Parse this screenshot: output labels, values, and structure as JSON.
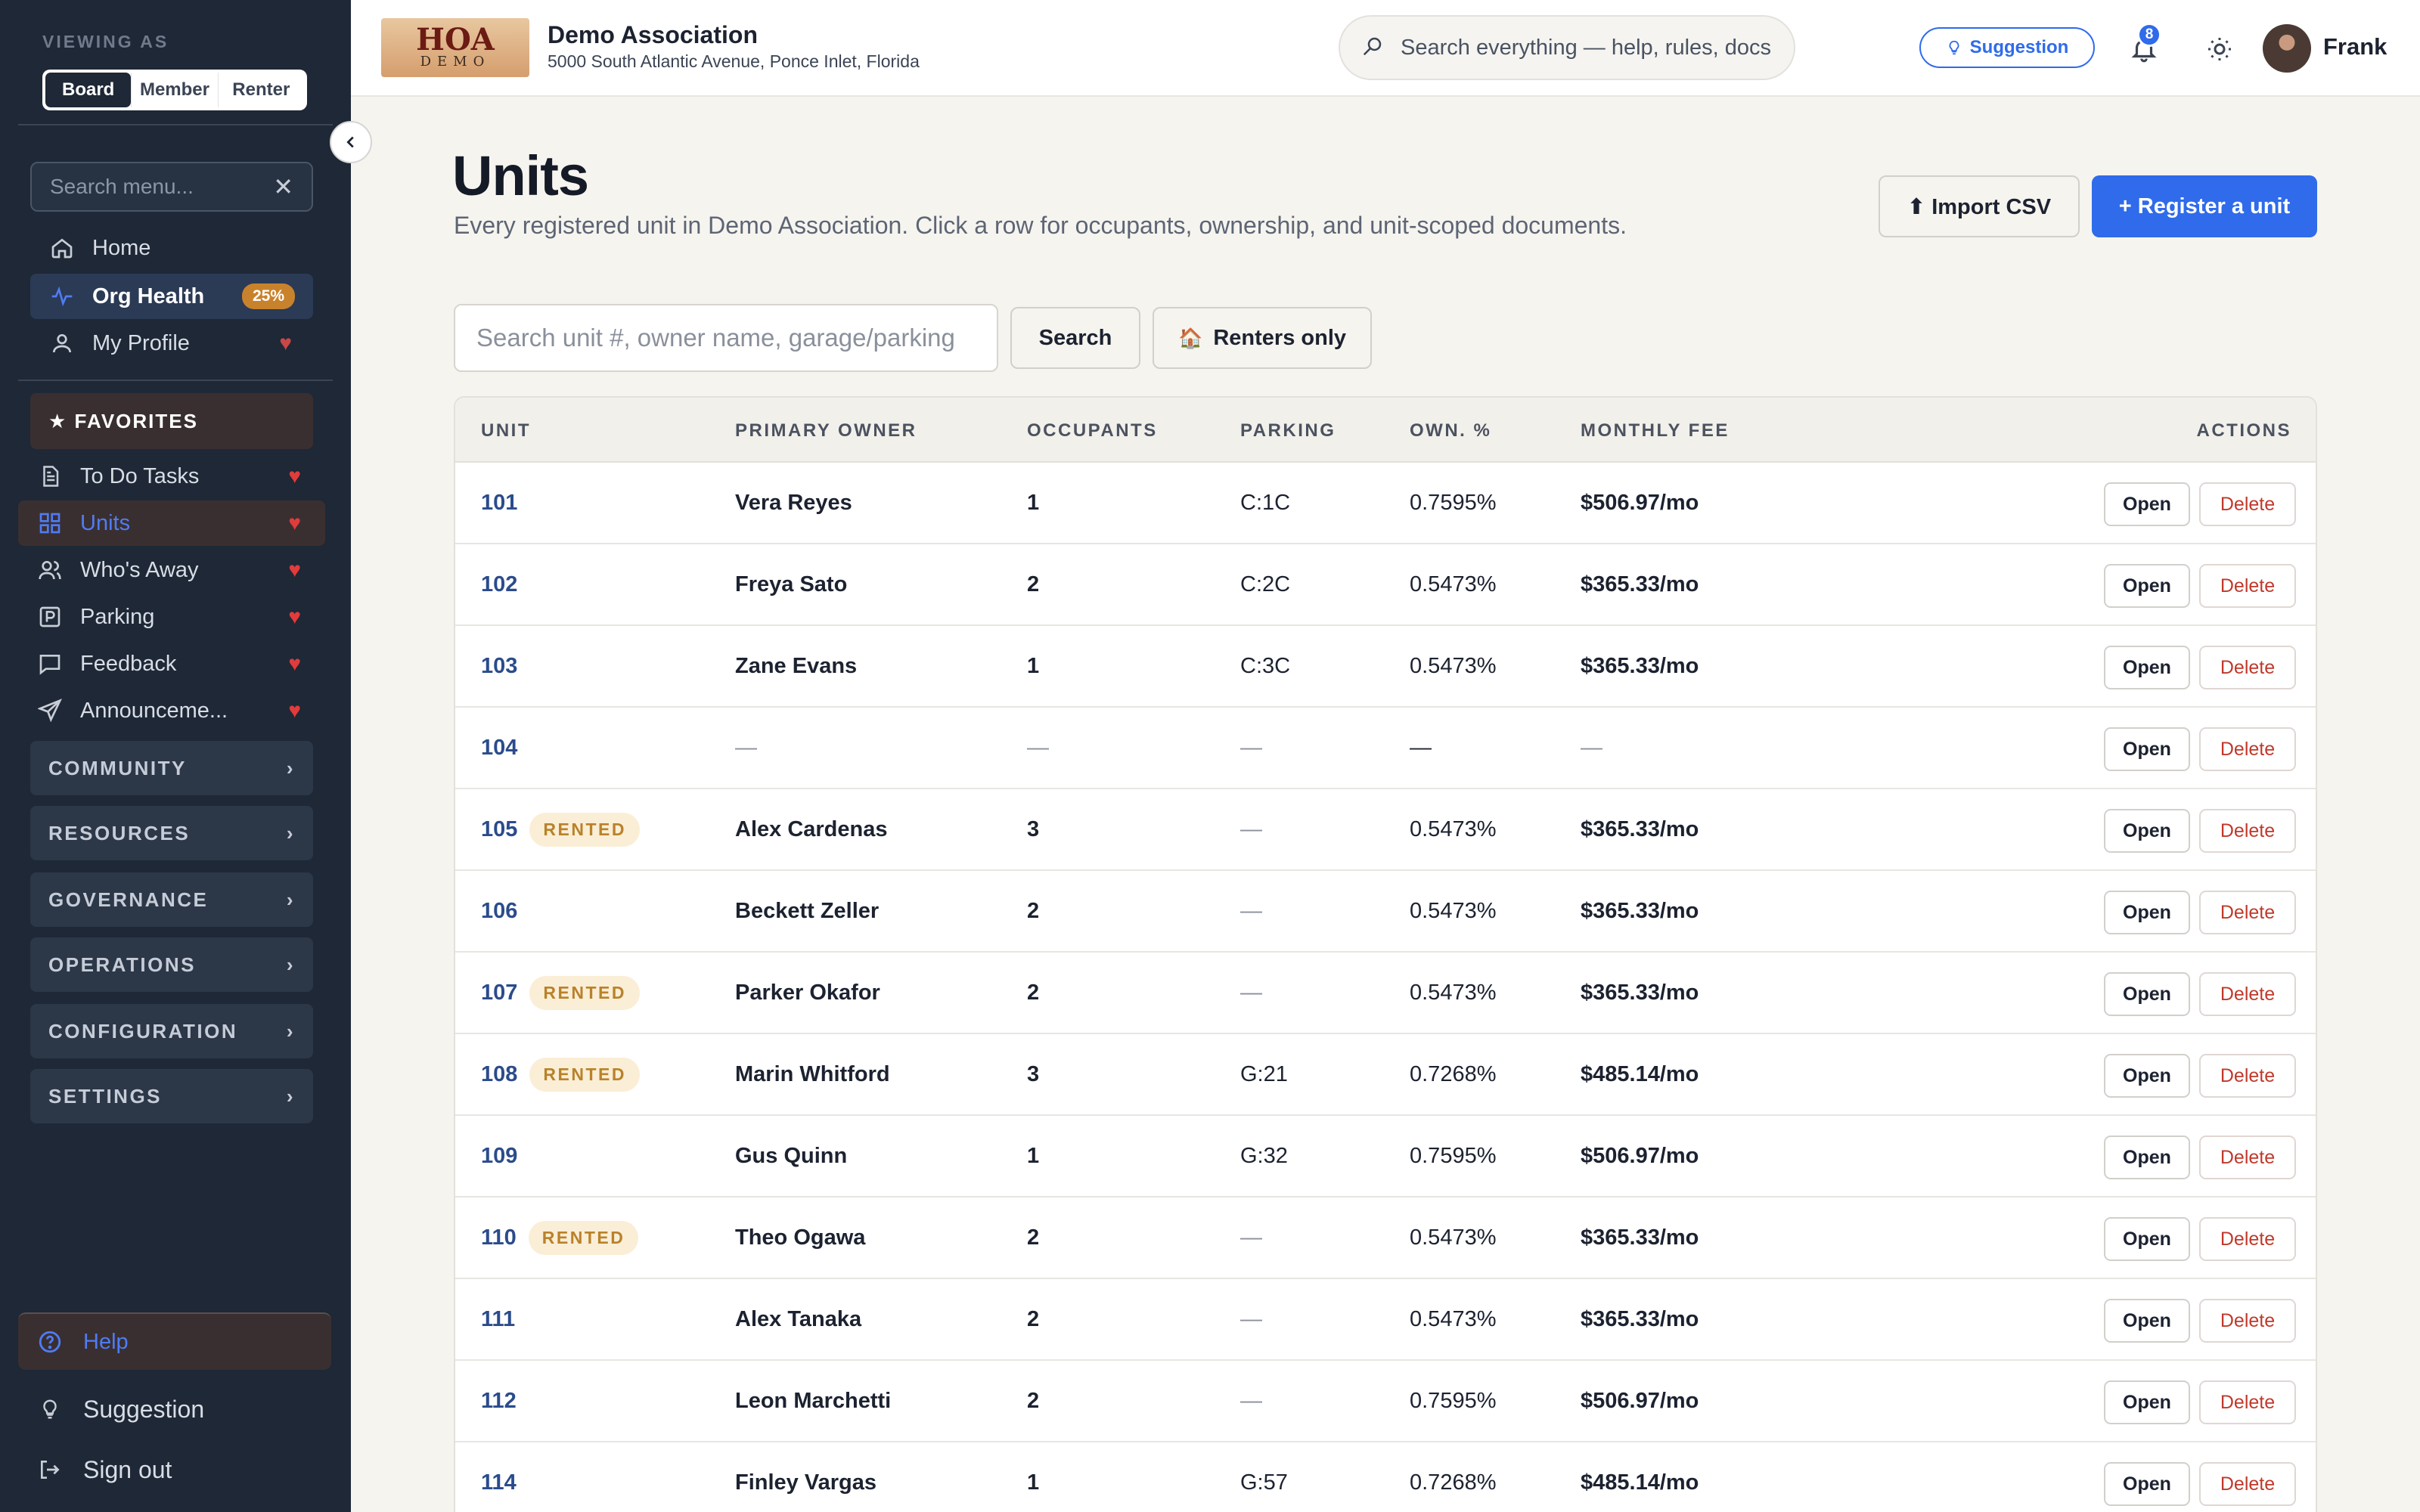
{
  "sidebar": {
    "viewing_as_label": "VIEWING AS",
    "roles": [
      "Board",
      "Member",
      "Renter"
    ],
    "active_role": "Board",
    "menu_search_placeholder": "Search menu...",
    "primary": [
      {
        "label": "Home",
        "icon": "home-icon"
      },
      {
        "label": "Org Health",
        "icon": "pulse-icon",
        "badge": "25%"
      },
      {
        "label": "My Profile",
        "icon": "user-icon"
      }
    ],
    "favorites_title": "★ FAVORITES",
    "favorites": [
      {
        "label": "To Do Tasks",
        "icon": "document-icon"
      },
      {
        "label": "Units",
        "icon": "grid-icon",
        "active": true
      },
      {
        "label": "Who's Away",
        "icon": "users-icon"
      },
      {
        "label": "Parking",
        "icon": "parking-icon"
      },
      {
        "label": "Feedback",
        "icon": "chat-icon"
      },
      {
        "label": "Announceme...",
        "icon": "send-icon"
      }
    ],
    "sections": [
      "COMMUNITY",
      "RESOURCES",
      "GOVERNANCE",
      "OPERATIONS",
      "CONFIGURATION",
      "SETTINGS"
    ],
    "help": "Help",
    "suggestion": "Suggestion",
    "sign_out": "Sign out"
  },
  "header": {
    "logo_top": "HOA",
    "logo_bottom": "DEMO",
    "org_name": "Demo Association",
    "org_address": "5000 South Atlantic Avenue, Ponce Inlet, Florida",
    "search_placeholder": "Search everything — help, rules, docs, members",
    "suggestion_label": "Suggestion",
    "notification_count": "8",
    "user_name": "Frank"
  },
  "page": {
    "title": "Units",
    "subtitle": "Every registered unit in Demo Association. Click a row for occupants, ownership, and unit-scoped documents.",
    "import_label": "⬆ Import CSV",
    "register_label": "+ Register a unit",
    "unit_search_placeholder": "Search unit #, owner name, garage/parking",
    "search_button": "Search",
    "renters_button": "Renters only"
  },
  "table": {
    "columns": [
      "UNIT",
      "PRIMARY OWNER",
      "OCCUPANTS",
      "PARKING",
      "OWN. %",
      "MONTHLY FEE",
      "ACTIONS"
    ],
    "open_label": "Open",
    "delete_label": "Delete",
    "rented_label": "RENTED",
    "rows": [
      {
        "unit": "101",
        "rented": false,
        "owner": "Vera Reyes",
        "occupants": "1",
        "parking": "C:1C",
        "own_pct": "0.7595%",
        "fee": "$506.97/mo"
      },
      {
        "unit": "102",
        "rented": false,
        "owner": "Freya Sato",
        "occupants": "2",
        "parking": "C:2C",
        "own_pct": "0.5473%",
        "fee": "$365.33/mo"
      },
      {
        "unit": "103",
        "rented": false,
        "owner": "Zane Evans",
        "occupants": "1",
        "parking": "C:3C",
        "own_pct": "0.5473%",
        "fee": "$365.33/mo"
      },
      {
        "unit": "104",
        "rented": false,
        "owner": "—",
        "occupants": "—",
        "parking": "—",
        "own_pct": "—",
        "fee": "—"
      },
      {
        "unit": "105",
        "rented": true,
        "owner": "Alex Cardenas",
        "occupants": "3",
        "parking": "—",
        "own_pct": "0.5473%",
        "fee": "$365.33/mo"
      },
      {
        "unit": "106",
        "rented": false,
        "owner": "Beckett Zeller",
        "occupants": "2",
        "parking": "—",
        "own_pct": "0.5473%",
        "fee": "$365.33/mo"
      },
      {
        "unit": "107",
        "rented": true,
        "owner": "Parker Okafor",
        "occupants": "2",
        "parking": "—",
        "own_pct": "0.5473%",
        "fee": "$365.33/mo"
      },
      {
        "unit": "108",
        "rented": true,
        "owner": "Marin Whitford",
        "occupants": "3",
        "parking": "G:21",
        "own_pct": "0.7268%",
        "fee": "$485.14/mo"
      },
      {
        "unit": "109",
        "rented": false,
        "owner": "Gus Quinn",
        "occupants": "1",
        "parking": "G:32",
        "own_pct": "0.7595%",
        "fee": "$506.97/mo"
      },
      {
        "unit": "110",
        "rented": true,
        "owner": "Theo Ogawa",
        "occupants": "2",
        "parking": "—",
        "own_pct": "0.5473%",
        "fee": "$365.33/mo"
      },
      {
        "unit": "111",
        "rented": false,
        "owner": "Alex Tanaka",
        "occupants": "2",
        "parking": "—",
        "own_pct": "0.5473%",
        "fee": "$365.33/mo"
      },
      {
        "unit": "112",
        "rented": false,
        "owner": "Leon Marchetti",
        "occupants": "2",
        "parking": "—",
        "own_pct": "0.7595%",
        "fee": "$506.97/mo"
      },
      {
        "unit": "114",
        "rented": false,
        "owner": "Finley Vargas",
        "occupants": "1",
        "parking": "G:57",
        "own_pct": "0.7268%",
        "fee": "$485.14/mo"
      }
    ]
  },
  "colors": {
    "accent": "#2f6bea",
    "sidebar_bg": "#1e2836",
    "heart": "#e23b3b",
    "rented_bg": "#fbeed6",
    "rented_text": "#b9822a"
  }
}
